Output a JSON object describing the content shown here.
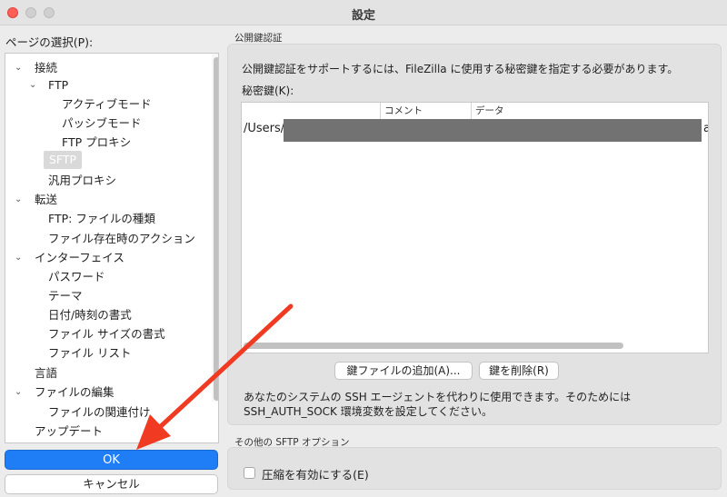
{
  "window": {
    "title": "設定"
  },
  "sidebar": {
    "label": "ページの選択(P):",
    "tree": [
      "接続",
      "FTP",
      "アクティブモード",
      "パッシブモード",
      "FTP プロキシ",
      "SFTP",
      "汎用プロキシ",
      "転送",
      "FTP: ファイルの種類",
      "ファイル存在時のアクション",
      "インターフェイス",
      "パスワード",
      "テーマ",
      "日付/時刻の書式",
      "ファイル サイズの書式",
      "ファイル リスト",
      "言語",
      "ファイルの編集",
      "ファイルの関連付け",
      "アップデート"
    ],
    "selected": "SFTP"
  },
  "footer": {
    "ok_label": "OK",
    "cancel_label": "キャンセル"
  },
  "pubkey": {
    "group_title": "公開鍵認証",
    "description": "公開鍵認証をサポートするには、FileZilla に使用する秘密鍵を指定する必要があります。",
    "key_label": "秘密鍵(K):",
    "columns": {
      "comment": "コメント",
      "data": "データ"
    },
    "row_path_prefix": "/Users/",
    "row_tail": "a(",
    "add_button": "鍵ファイルの追加(A)...",
    "remove_button": "鍵を削除(R)",
    "note_line1": "あなたのシステムの SSH エージェントを代わりに使用できます。そのためには",
    "note_line2": "SSH_AUTH_SOCK 環境変数を設定してください。"
  },
  "other": {
    "group_title": "その他の SFTP オプション",
    "compression_label": "圧縮を有効にする(E)",
    "compression_checked": false
  },
  "colors": {
    "accent": "#1f7df6",
    "annotation_arrow": "#f03a22",
    "redaction": "#727272"
  }
}
